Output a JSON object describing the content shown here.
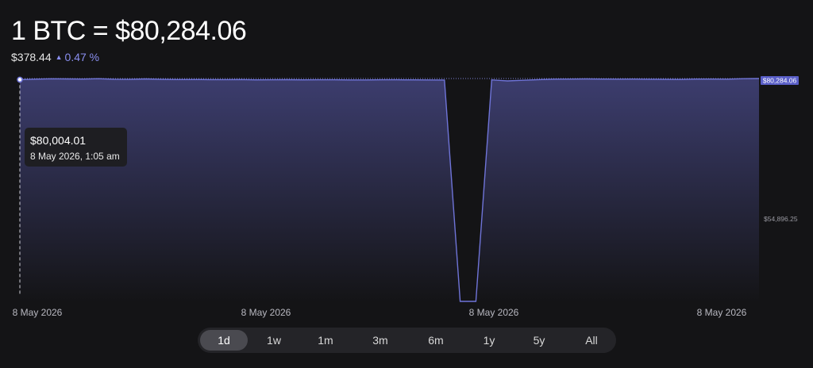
{
  "header": {
    "title": "1 BTC = $80,284.06",
    "change_abs": "$378.44",
    "change_pct": "0.47 %",
    "change_icon": "triangle-up-icon"
  },
  "tooltip": {
    "value": "$80,004.01",
    "date": "8 May 2026, 1:05 am"
  },
  "ranges": [
    "1d",
    "1w",
    "1m",
    "3m",
    "6m",
    "1y",
    "5y",
    "All"
  ],
  "active_range": "1d",
  "colors": {
    "accent": "#8a8ff0",
    "line": "#6f74d8",
    "fill_top": "#3c3d6e",
    "background": "#141416"
  },
  "chart_data": {
    "type": "area",
    "title": "",
    "xlabel": "",
    "ylabel": "",
    "y_tick_labels": [
      "$80,284.06",
      "$54,896.25"
    ],
    "x_tick_labels": [
      "8 May 2026",
      "8 May 2026",
      "8 May 2026",
      "8 May 2026"
    ],
    "ylim": [
      25000,
      80284.06
    ],
    "grid": false,
    "series": [
      {
        "values": [
          80004.01,
          80120,
          80230,
          80180,
          80150,
          80250,
          80100,
          80060,
          80180,
          80060,
          80030,
          80020,
          80000,
          80010,
          80020,
          79950,
          79980,
          79990,
          79950,
          79970,
          79980,
          79930,
          79940,
          79980,
          79970,
          79960,
          79930,
          79920,
          25200,
          25200,
          79950,
          79700,
          79850,
          80000,
          80120,
          80140,
          80180,
          80150,
          80120,
          80140,
          80100,
          80060,
          80050,
          80150,
          80150,
          80120,
          80250,
          80284.06
        ]
      }
    ],
    "highlight": {
      "index": 0,
      "value": 80004.01
    }
  }
}
